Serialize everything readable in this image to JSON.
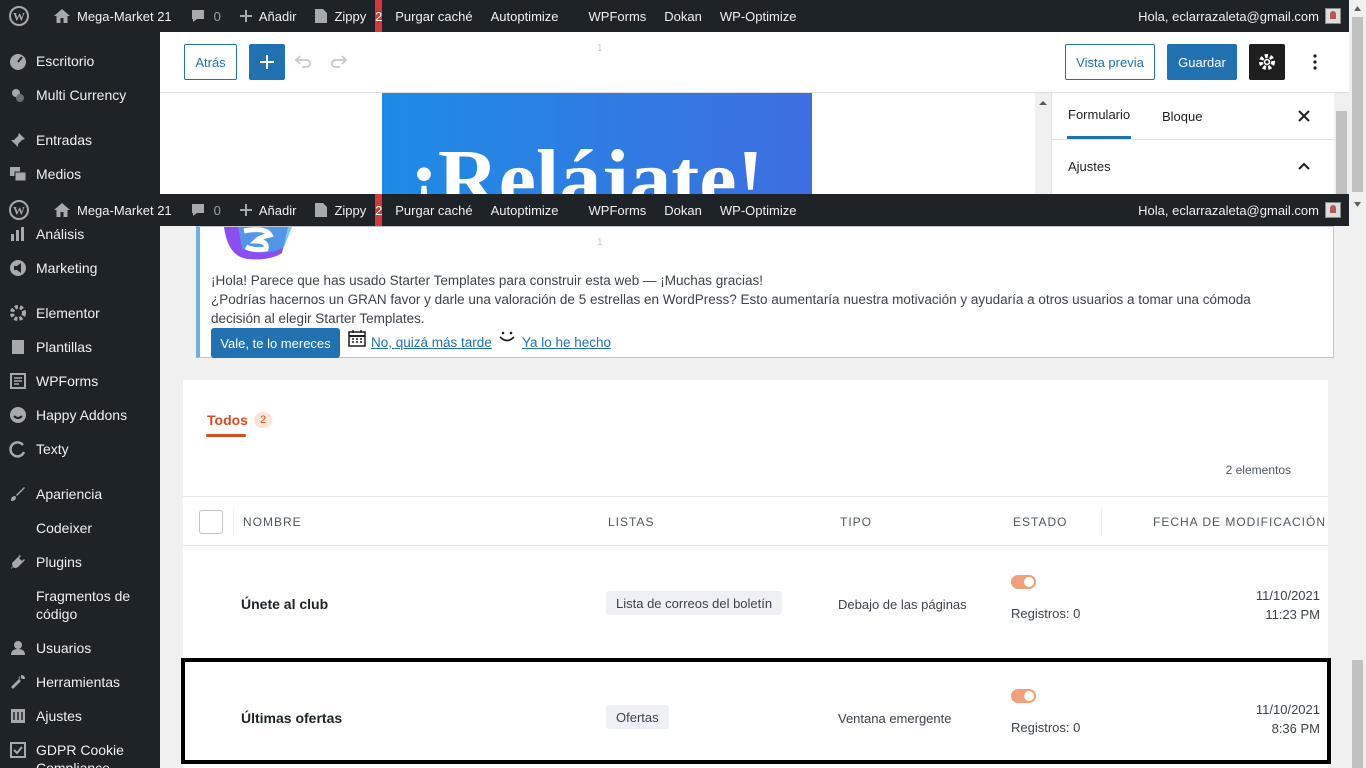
{
  "adminbar": {
    "site_name": "Mega-Market 21",
    "comments_count": "0",
    "add_new": "Añadir",
    "theme": "Zippy",
    "updates_badge": "2",
    "purge": "Purgar caché",
    "autoptimize": "Autoptimize",
    "wpforms": "WPForms",
    "dokan": "Dokan",
    "wpoptimize": "WP-Optimize",
    "greeting": "Hola, eclarrazaleta@gmail.com"
  },
  "sidebar": {
    "items": [
      {
        "label": "Escritorio",
        "icon": "dashboard-icon"
      },
      {
        "label": "Multi Currency",
        "icon": "currency-icon"
      },
      {
        "label": "Entradas",
        "icon": "pin-icon"
      },
      {
        "label": "Medios",
        "icon": "media-icon"
      },
      {
        "label": "Análisis",
        "icon": "analytics-icon"
      },
      {
        "label": "Marketing",
        "icon": "megaphone-icon"
      },
      {
        "label": "Elementor",
        "icon": "elementor-icon"
      },
      {
        "label": "Plantillas",
        "icon": "templates-icon"
      },
      {
        "label": "WPForms",
        "icon": "forms-icon"
      },
      {
        "label": "Happy Addons",
        "icon": "happy-icon"
      },
      {
        "label": "Texty",
        "icon": "texty-icon"
      },
      {
        "label": "Apariencia",
        "icon": "brush-icon"
      },
      {
        "label": "Codeixer",
        "icon": ""
      },
      {
        "label": "Plugins",
        "icon": "plugin-icon"
      },
      {
        "label": "Fragmentos de código",
        "icon": ""
      },
      {
        "label": "Usuarios",
        "icon": "users-icon"
      },
      {
        "label": "Herramientas",
        "icon": "wrench-icon"
      },
      {
        "label": "Ajustes",
        "icon": "settings-icon"
      },
      {
        "label": "GDPR Cookie Compliance",
        "icon": "check-icon"
      }
    ]
  },
  "editor": {
    "back": "Atrás",
    "preview": "Vista previa",
    "save": "Guardar",
    "hero_text": "¡Relájate!",
    "panel_tab_form": "Formulario",
    "panel_tab_block": "Bloque",
    "panel_section": "Ajustes"
  },
  "notice": {
    "line1": "¡Hola! Parece que has usado Starter Templates para construir esta web — ¡Muchas gracias!",
    "line2": "¿Podrías hacernos un GRAN favor y darle una valoración de 5 estrellas en WordPress? Esto aumentaría nuestra motivación y ayudaría a otros usuarios a tomar una cómoda",
    "line3": "decisión al elegir Starter Templates.",
    "button": "Vale, te lo mereces",
    "later": "No, quizá más tarde",
    "done": "Ya lo he hecho"
  },
  "list": {
    "tab_label": "Todos",
    "tab_count": "2",
    "items_count": "2 elementos",
    "columns": [
      "Nombre",
      "Listas",
      "Tipo",
      "Estado",
      "Fecha de modificación"
    ],
    "rows": [
      {
        "name": "Únete al club",
        "list": "Lista de correos del boletín",
        "type": "Debajo de las páginas",
        "status_on": true,
        "records": "Registros: 0",
        "date": "11/10/2021",
        "time": "11:23 PM"
      },
      {
        "name": "Últimas ofertas",
        "list": "Ofertas",
        "type": "Ventana emergente",
        "status_on": true,
        "records": "Registros: 0",
        "date": "11/10/2021",
        "time": "8:36 PM"
      }
    ]
  },
  "colors": {
    "adminbar": "#1d2327",
    "primary": "#2271b1",
    "accent": "#d54e21",
    "toggle": "#f0a07a"
  }
}
